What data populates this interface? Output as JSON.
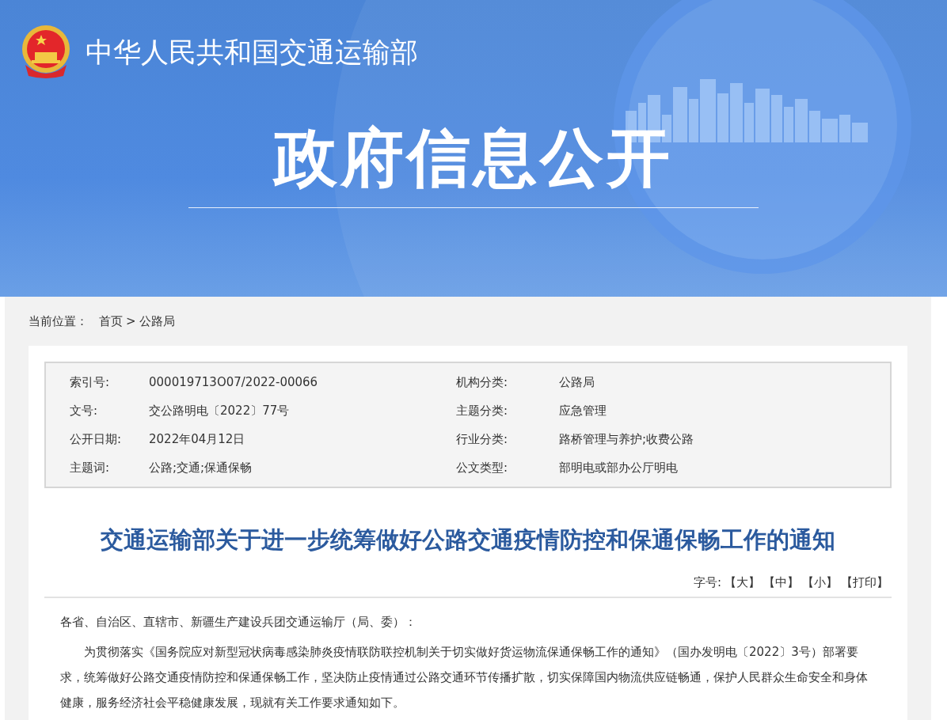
{
  "header": {
    "site_name": "中华人民共和国交通运输部",
    "banner_title": "政府信息公开"
  },
  "breadcrumb": {
    "label": "当前位置：",
    "items": [
      {
        "text": "首页"
      },
      {
        "text": "公路局"
      }
    ],
    "separator": ">"
  },
  "meta": {
    "rows": [
      {
        "left_label": "索引号:",
        "left_value": "000019713O07/2022-00066",
        "right_label": "机构分类:",
        "right_value": "公路局"
      },
      {
        "left_label": "文号:",
        "left_value": "交公路明电〔2022〕77号",
        "right_label": "主题分类:",
        "right_value": "应急管理"
      },
      {
        "left_label": "公开日期:",
        "left_value": "2022年04月12日",
        "right_label": "行业分类:",
        "right_value": "路桥管理与养护;收费公路"
      },
      {
        "left_label": "主题词:",
        "left_value": "公路;交通;保通保畅",
        "right_label": "公文类型:",
        "right_value": "部明电或部办公厅明电"
      }
    ]
  },
  "article": {
    "title": "交通运输部关于进一步统筹做好公路交通疫情防控和保通保畅工作的通知",
    "font_size_label": "字号:",
    "font_size_options": [
      "【大】",
      "【中】",
      "【小】",
      "【打印】"
    ],
    "salutation": "各省、自治区、直辖市、新疆生产建设兵团交通运输厅（局、委）：",
    "paragraphs": [
      "为贯彻落实《国务院应对新型冠状病毒感染肺炎疫情联防联控机制关于切实做好货运物流保通保畅工作的通知》（国办发明电〔2022〕3号）部署要求，统筹做好公路交通疫情防控和保通保畅工作，坚决防止疫情通过公路交通环节传播扩散，切实保障国内物流供应链畅通，保护人民群众生命安全和身体健康，服务经济社会平稳健康发展，现就有关工作要求通知如下。"
    ]
  }
}
